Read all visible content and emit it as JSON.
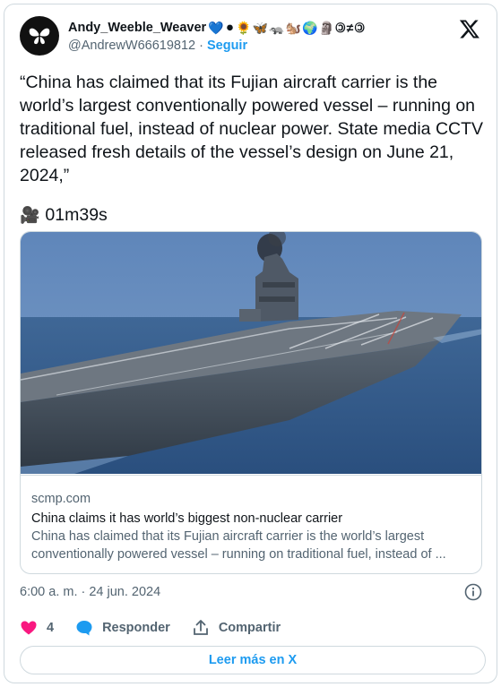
{
  "author": {
    "display_name": "Andy_Weeble_Weaver",
    "emojis": [
      "💙",
      "⚫",
      "🌻",
      "🦋",
      "🦡",
      "🐿️",
      "🌍",
      "🗿",
      "🄯",
      "≠",
      "🄯"
    ],
    "handle": "@AndrewW66619812",
    "separator": " · ",
    "follow_label": "Seguir"
  },
  "tweet": {
    "text": "“China has claimed that its Fujian aircraft carrier is the world’s largest conventionally powered vessel – running on traditional fuel, instead of nuclear power. State media CCTV released fresh details of the vessel’s design on June 21, 2024,”",
    "video_emoji": "🎥",
    "duration": "01m39s"
  },
  "link_card": {
    "domain": "scmp.com",
    "title": "China claims it has world’s biggest non-nuclear carrier",
    "description": "China has claimed that its Fujian aircraft carrier is the world’s largest conventionally powered vessel – running on traditional fuel, instead of ..."
  },
  "meta": {
    "timestamp": "6:00 a. m. · 24 jun. 2024"
  },
  "actions": {
    "likes": "4",
    "reply_label": "Responder",
    "share_label": "Compartir"
  },
  "read_more_label": "Leer más en X",
  "colors": {
    "accent": "#1d9bf0",
    "like": "#f91880",
    "muted": "#536471",
    "border": "#cfd9de"
  }
}
